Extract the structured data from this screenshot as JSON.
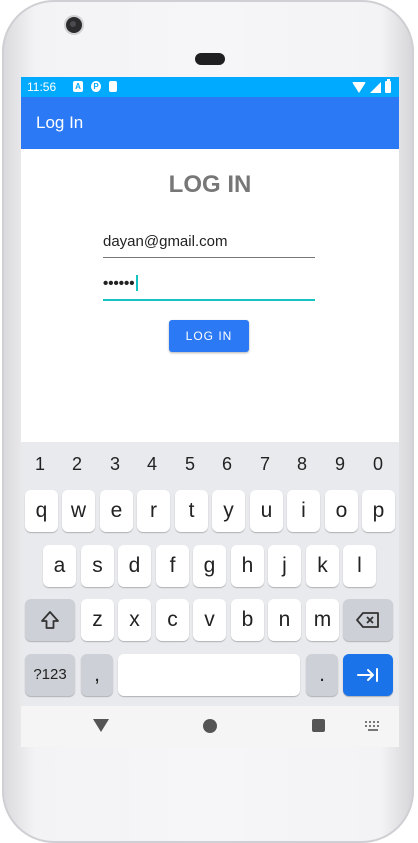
{
  "status_bar": {
    "time": "11:56",
    "notif_icons": [
      "A",
      "P",
      "▮"
    ]
  },
  "app_bar": {
    "title": "Log In"
  },
  "form": {
    "title": "LOG IN",
    "email_value": "dayan@gmail.com",
    "password_value": "••••••",
    "submit_label": "LOG IN"
  },
  "keyboard": {
    "number_row": [
      "1",
      "2",
      "3",
      "4",
      "5",
      "6",
      "7",
      "8",
      "9",
      "0"
    ],
    "row1": [
      "q",
      "w",
      "e",
      "r",
      "t",
      "y",
      "u",
      "i",
      "o",
      "p"
    ],
    "row2": [
      "a",
      "s",
      "d",
      "f",
      "g",
      "h",
      "j",
      "k",
      "l"
    ],
    "row3": [
      "z",
      "x",
      "c",
      "v",
      "b",
      "n",
      "m"
    ],
    "symbols_label": "?123",
    "comma": ",",
    "period": ".",
    "space_label": ""
  },
  "colors": {
    "status_bar": "#00aaff",
    "app_bar": "#2b79f5",
    "accent_input": "#15c3c3",
    "keyboard_action": "#1a73e8"
  },
  "icons": [
    "camera-icon",
    "wifi-icon",
    "signal-icon",
    "battery-icon",
    "shift-icon",
    "backspace-icon",
    "next-field-icon",
    "back-icon",
    "home-icon",
    "recents-icon",
    "keyboard-switch-icon"
  ]
}
